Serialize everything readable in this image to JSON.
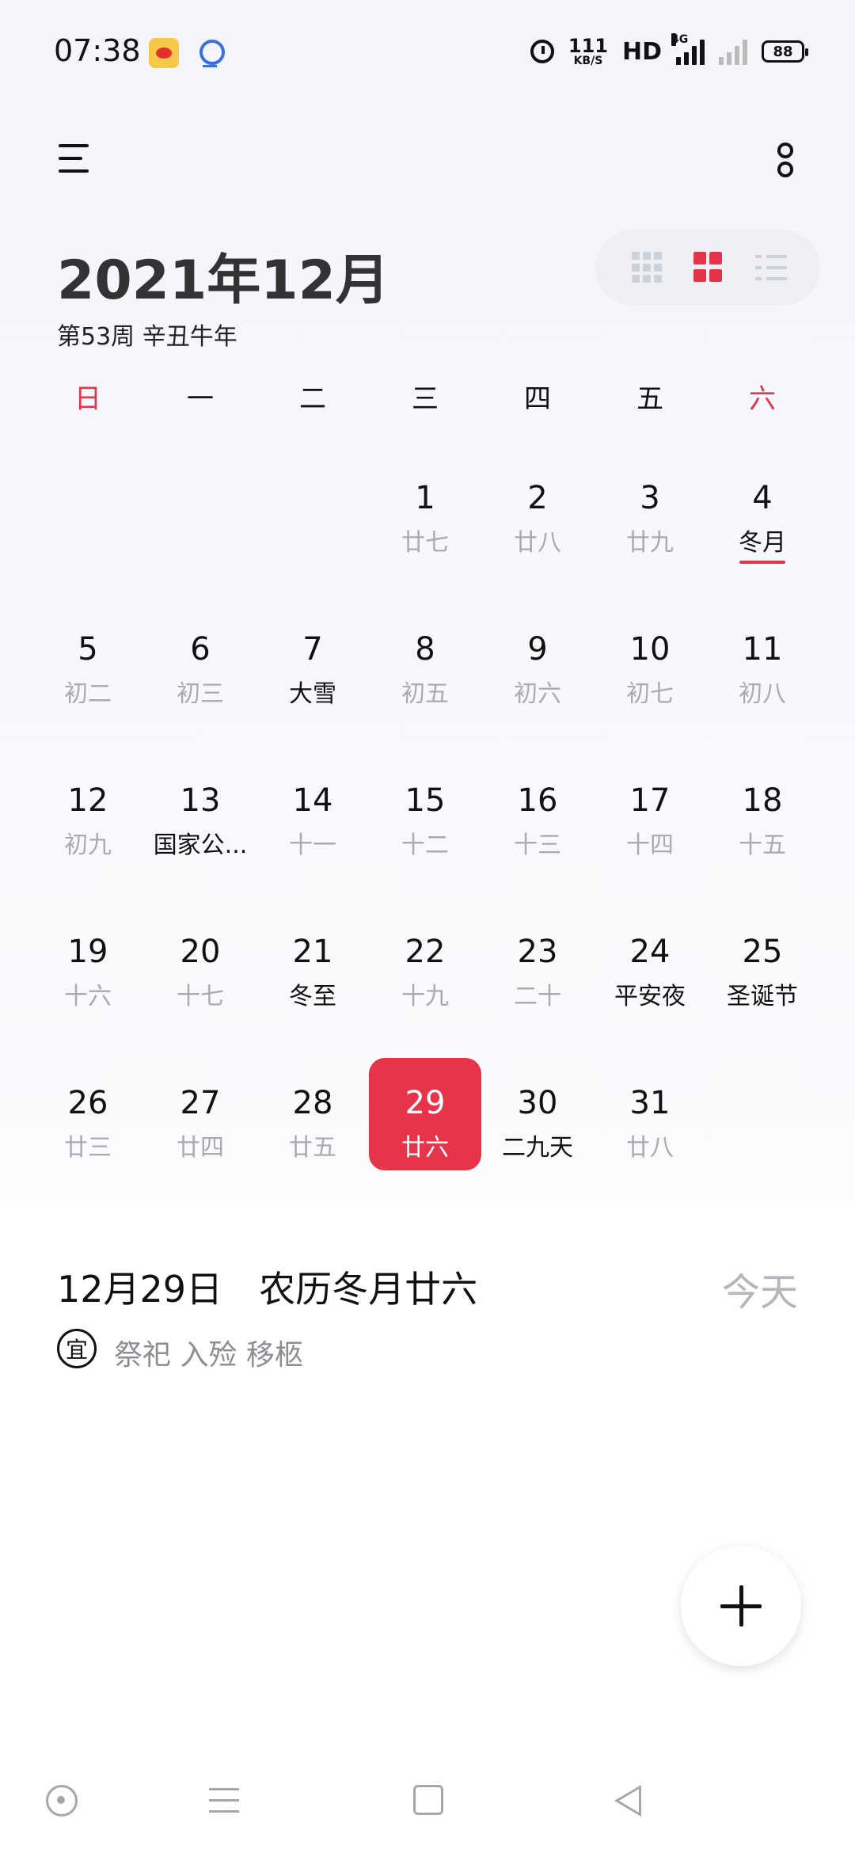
{
  "status_bar": {
    "time": "07:38",
    "net_speed_value": "111",
    "net_speed_unit": "KB/S",
    "hd_label": "HD",
    "network_tag": "4G",
    "battery": "88"
  },
  "header": {
    "month_title": "2021年12月",
    "subtitle": "第53周 辛丑牛年"
  },
  "weekdays": [
    "日",
    "一",
    "二",
    "三",
    "四",
    "五",
    "六"
  ],
  "calendar": {
    "days": [
      {
        "d": "1",
        "sub": "廿七",
        "col": 3,
        "row": 0
      },
      {
        "d": "2",
        "sub": "廿八",
        "col": 4,
        "row": 0
      },
      {
        "d": "3",
        "sub": "廿九",
        "col": 5,
        "row": 0
      },
      {
        "d": "4",
        "sub": "冬月",
        "col": 6,
        "row": 0,
        "festival": true,
        "month_mark": true
      },
      {
        "d": "5",
        "sub": "初二",
        "col": 0,
        "row": 1
      },
      {
        "d": "6",
        "sub": "初三",
        "col": 1,
        "row": 1
      },
      {
        "d": "7",
        "sub": "大雪",
        "col": 2,
        "row": 1,
        "festival": true
      },
      {
        "d": "8",
        "sub": "初五",
        "col": 3,
        "row": 1
      },
      {
        "d": "9",
        "sub": "初六",
        "col": 4,
        "row": 1
      },
      {
        "d": "10",
        "sub": "初七",
        "col": 5,
        "row": 1
      },
      {
        "d": "11",
        "sub": "初八",
        "col": 6,
        "row": 1
      },
      {
        "d": "12",
        "sub": "初九",
        "col": 0,
        "row": 2
      },
      {
        "d": "13",
        "sub": "国家公...",
        "col": 1,
        "row": 2,
        "festival": true
      },
      {
        "d": "14",
        "sub": "十一",
        "col": 2,
        "row": 2
      },
      {
        "d": "15",
        "sub": "十二",
        "col": 3,
        "row": 2
      },
      {
        "d": "16",
        "sub": "十三",
        "col": 4,
        "row": 2
      },
      {
        "d": "17",
        "sub": "十四",
        "col": 5,
        "row": 2
      },
      {
        "d": "18",
        "sub": "十五",
        "col": 6,
        "row": 2
      },
      {
        "d": "19",
        "sub": "十六",
        "col": 0,
        "row": 3
      },
      {
        "d": "20",
        "sub": "十七",
        "col": 1,
        "row": 3
      },
      {
        "d": "21",
        "sub": "冬至",
        "col": 2,
        "row": 3,
        "festival": true
      },
      {
        "d": "22",
        "sub": "十九",
        "col": 3,
        "row": 3
      },
      {
        "d": "23",
        "sub": "二十",
        "col": 4,
        "row": 3
      },
      {
        "d": "24",
        "sub": "平安夜",
        "col": 5,
        "row": 3,
        "festival": true
      },
      {
        "d": "25",
        "sub": "圣诞节",
        "col": 6,
        "row": 3,
        "festival": true
      },
      {
        "d": "26",
        "sub": "廿三",
        "col": 0,
        "row": 4
      },
      {
        "d": "27",
        "sub": "廿四",
        "col": 1,
        "row": 4
      },
      {
        "d": "28",
        "sub": "廿五",
        "col": 2,
        "row": 4
      },
      {
        "d": "29",
        "sub": "廿六",
        "col": 3,
        "row": 4,
        "today": true
      },
      {
        "d": "30",
        "sub": "二九天",
        "col": 4,
        "row": 4,
        "festival": true
      },
      {
        "d": "31",
        "sub": "廿八",
        "col": 5,
        "row": 4
      }
    ]
  },
  "selected_day": {
    "date": "12月29日",
    "lunar": "农历冬月廿六",
    "today_label": "今天",
    "yi_label": "宜",
    "yi_text": "祭祀 入殓 移柩"
  },
  "colors": {
    "accent": "#e8344a",
    "muted_text": "#a9abb0"
  },
  "icons": {
    "menu": "menu-icon",
    "more": "more-vertical-icon",
    "add": "plus-icon"
  }
}
